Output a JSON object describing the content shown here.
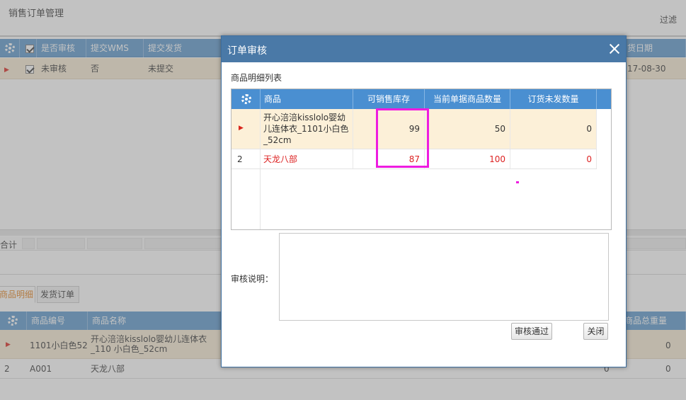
{
  "app": {
    "title": "销售订单管理",
    "filter_label": "过滤"
  },
  "bg_table": {
    "headers": [
      "是否审核",
      "提交WMS",
      "提交发货",
      "货日期"
    ],
    "row": {
      "audit": "未审核",
      "wms": "否",
      "ship": "未提交",
      "date": "17-08-30"
    },
    "total_label": "合计"
  },
  "bg_tabs": [
    "商品明细",
    "发货订单"
  ],
  "bg_detail": {
    "headers": [
      "商品编号",
      "商品名称",
      "商品总重量"
    ],
    "rows": [
      {
        "idx": "",
        "code": "1101小白色52",
        "name": "开心涪涪kisslolo婴幼儿连体衣_110 小白色_52cm",
        "weight": "0",
        "extra": ""
      },
      {
        "idx": "2",
        "code": "A001",
        "name": "天龙八部",
        "weight": "0",
        "extra": "0"
      }
    ]
  },
  "dialog": {
    "title": "订单审核",
    "section_label": "商品明细列表",
    "columns": [
      "商品",
      "可销售库存",
      "当前单据商品数量",
      "订货未发数量"
    ],
    "rows": [
      {
        "idx": "",
        "product": "开心涪涪kisslolo婴幼儿连体衣_1101小白色_52cm",
        "stock": "99",
        "qty": "50",
        "pending": "0"
      },
      {
        "idx": "2",
        "product": "天龙八部",
        "stock": "87",
        "qty": "100",
        "pending": "0"
      }
    ],
    "note_label": "审核说明：",
    "note_value": "",
    "approve_label": "审核通过",
    "close_label": "关闭"
  },
  "colors": {
    "header_blue": "#4a8fd1",
    "title_blue": "#4a79a7",
    "highlight": "#ee1ce0",
    "row_selected": "#fcf0d8",
    "alert_red": "#d22"
  }
}
